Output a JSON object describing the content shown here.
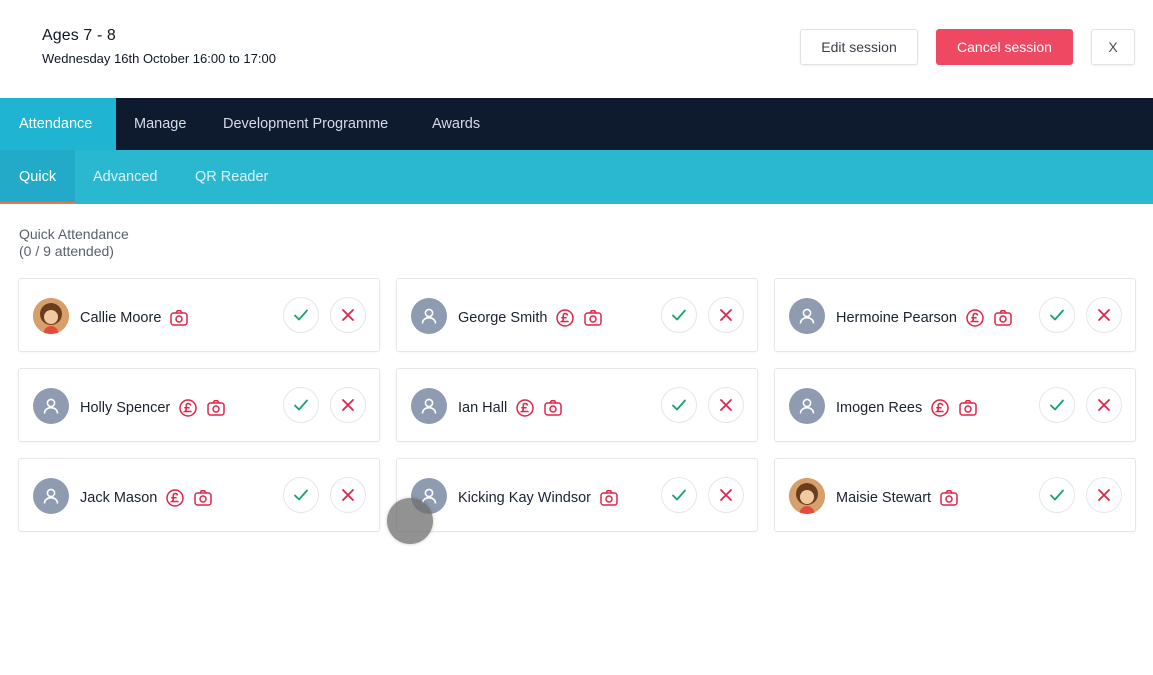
{
  "header": {
    "title": "Ages 7 - 8",
    "subtitle": "Wednesday 16th October 16:00 to 17:00",
    "edit_label": "Edit session",
    "cancel_label": "Cancel session",
    "close_label": "X"
  },
  "nav_main": {
    "tabs": [
      {
        "label": "Attendance",
        "active": true
      },
      {
        "label": "Manage",
        "active": false
      },
      {
        "label": "Development Programme",
        "active": false
      },
      {
        "label": "Awards",
        "active": false
      }
    ]
  },
  "nav_sub": {
    "tabs": [
      {
        "label": "Quick",
        "active": true
      },
      {
        "label": "Advanced",
        "active": false
      },
      {
        "label": "QR Reader",
        "active": false
      }
    ]
  },
  "attendance": {
    "heading": "Quick Attendance",
    "count": "(0 / 9 attended)",
    "people": [
      {
        "name": "Callie Moore",
        "has_photo": true,
        "payment_due": false
      },
      {
        "name": "George Smith",
        "has_photo": false,
        "payment_due": true
      },
      {
        "name": "Hermoine Pearson",
        "has_photo": false,
        "payment_due": true
      },
      {
        "name": "Holly Spencer",
        "has_photo": false,
        "payment_due": true
      },
      {
        "name": "Ian Hall",
        "has_photo": false,
        "payment_due": true
      },
      {
        "name": "Imogen Rees",
        "has_photo": false,
        "payment_due": true
      },
      {
        "name": "Jack Mason",
        "has_photo": false,
        "payment_due": true
      },
      {
        "name": "Kicking Kay Windsor",
        "has_photo": false,
        "payment_due": false
      },
      {
        "name": "Maisie Stewart",
        "has_photo": true,
        "payment_due": false
      }
    ]
  },
  "icons": {
    "payment": "pound-circle-icon",
    "camera": "camera-icon",
    "present": "check-icon",
    "absent": "cross-icon",
    "avatar_placeholder": "user-icon"
  },
  "colors": {
    "nav_dark": "#0e1a2e",
    "accent_teal": "#2ab8d0",
    "cancel_red": "#ef4862",
    "icon_red": "#e0244b",
    "check_green": "#18a36a"
  }
}
